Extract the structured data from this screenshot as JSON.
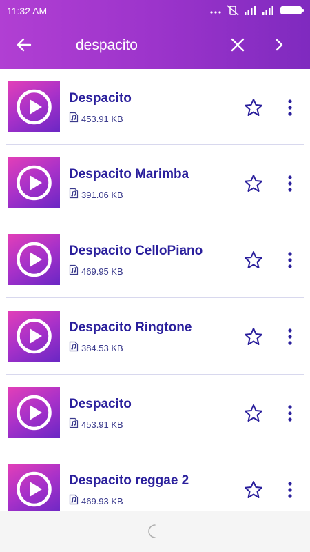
{
  "status_bar": {
    "time": "11:32 AM",
    "battery_icon": "battery-icon",
    "signal_icon": "signal-icon",
    "wifi_icon": "wifi-icon"
  },
  "toolbar": {
    "search_value": "despacito",
    "back_icon": "arrow-left-icon",
    "clear_icon": "close-icon",
    "next_icon": "chevron-right-icon",
    "background": "#9c34cb"
  },
  "results": [
    {
      "title": "Despacito",
      "size": "453.91 KB"
    },
    {
      "title": "Despacito Marimba",
      "size": "391.06 KB"
    },
    {
      "title": "Despacito CelloPiano",
      "size": "469.95 KB"
    },
    {
      "title": "Despacito Ringtone",
      "size": "384.53 KB"
    },
    {
      "title": "Despacito",
      "size": "453.91 KB"
    },
    {
      "title": "Despacito reggae 2",
      "size": "469.93 KB"
    }
  ],
  "colors": {
    "title": "#2a1f9c",
    "accent_pink": "#e23fb8",
    "accent_purple": "#6a27c4"
  },
  "footer": {
    "loading_icon": "loading-spinner-icon"
  }
}
